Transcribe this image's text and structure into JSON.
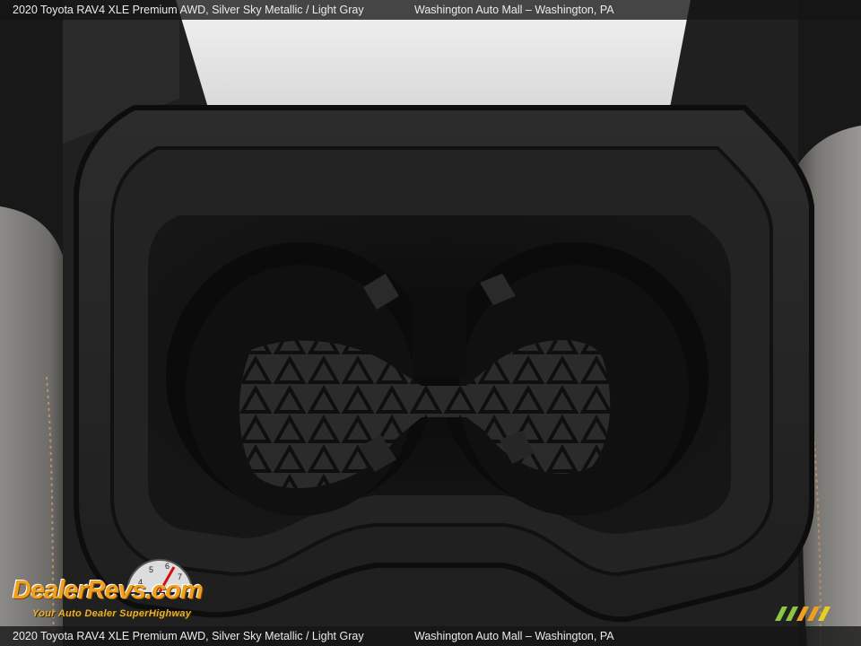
{
  "caption": {
    "vehicle": "2020 Toyota RAV4 XLE Premium AWD,  Silver Sky Metallic / Light Gray",
    "dealer": "Washington Auto Mall – Washington, PA"
  },
  "watermark": {
    "brand": "DealerRevs.com",
    "tagline": "Your Auto Dealer SuperHighway",
    "gauge_numbers": [
      "4",
      "5",
      "6",
      "7"
    ]
  },
  "colors": {
    "watermark_orange": "#f0a020",
    "mini_logo_green": "#8dc63f"
  }
}
